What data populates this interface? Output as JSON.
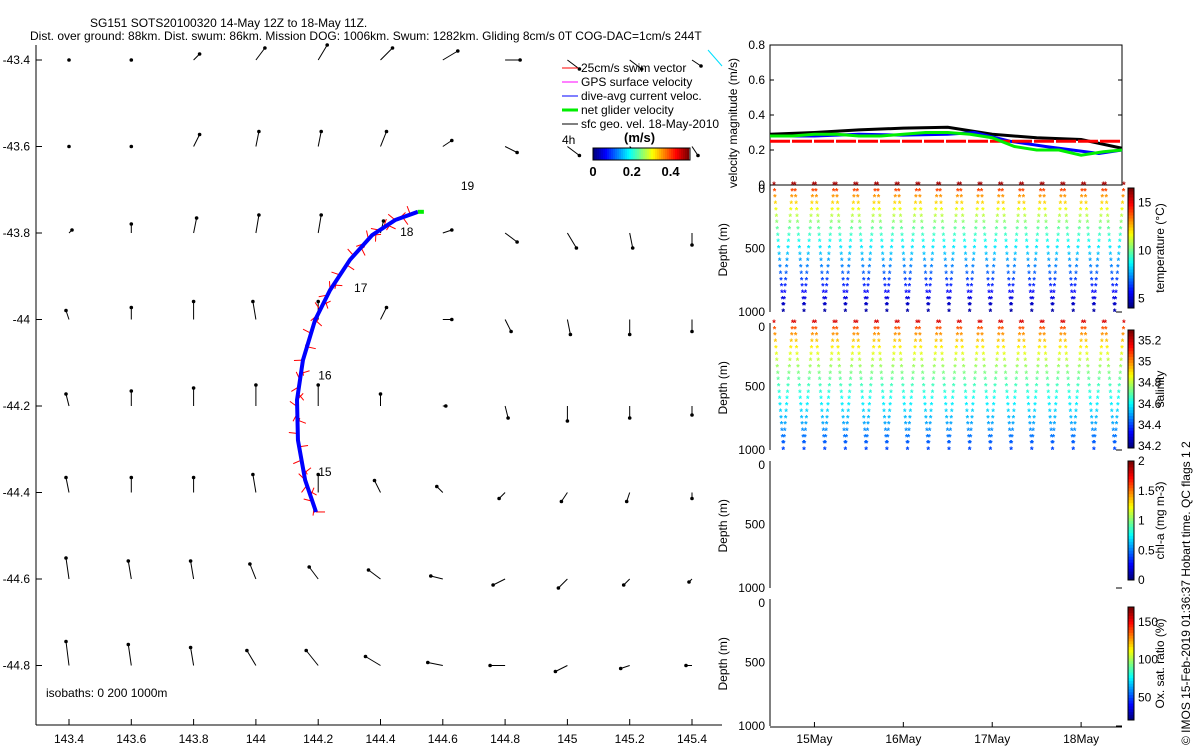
{
  "title": "SG151 SOTS20100320 14-May 12Z to 18-May 11Z.",
  "subtitle": "Dist. over ground: 88km. Dist. swum: 86km. Mission DOG: 1006km. Swum: 1282km. Gliding 8cm/s 0T COG-DAC=1cm/s 244T",
  "footer_note": "© IMOS 15-Feb-2019 01:36:37 Hobart time. QC flags 1  2",
  "chart_data": [
    {
      "type": "map-vector",
      "xlim": [
        143.3,
        145.5
      ],
      "ylim": [
        -44.92,
        -43.35
      ],
      "xticks": [
        "143.4",
        "143.6",
        "143.8",
        "144",
        "144.2",
        "144.4",
        "144.6",
        "144.8",
        "145",
        "145.2",
        "145.4"
      ],
      "yticks": [
        "-43.4",
        "-43.6",
        "-43.8",
        "-44",
        "-44.2",
        "-44.4",
        "-44.6",
        "-44.8"
      ],
      "isobath_label": "isobaths: 0   200  1000m",
      "legend": [
        {
          "label": "25cm/s swim vector",
          "color": "#ff0000"
        },
        {
          "label": "GPS surface velocity",
          "color": "#ff00ff"
        },
        {
          "label": "dive-avg current veloc.",
          "color": "#0000ff"
        },
        {
          "label": "net glider velocity",
          "color": "#00ee00"
        },
        {
          "label": "sfc geo. vel. 18-May-2010",
          "color": "#000000"
        }
      ],
      "time_label": "4h",
      "colorbar": {
        "label": "(m/s)",
        "range": [
          0,
          0.5
        ],
        "ticks": [
          "0",
          "0.2",
          "0.4"
        ]
      },
      "track": [
        [
          144.193,
          -44.445
        ],
        [
          144.158,
          -44.371
        ],
        [
          144.135,
          -44.279
        ],
        [
          144.132,
          -44.186
        ],
        [
          144.151,
          -44.094
        ],
        [
          144.19,
          -44.001
        ],
        [
          144.238,
          -43.932
        ],
        [
          144.302,
          -43.862
        ],
        [
          144.373,
          -43.805
        ],
        [
          144.447,
          -43.77
        ],
        [
          144.52,
          -43.751
        ]
      ],
      "day_labels": [
        {
          "t": "15",
          "lon": 144.2,
          "lat": -44.353
        },
        {
          "t": "16",
          "lon": 144.2,
          "lat": -44.13
        },
        {
          "t": "17",
          "lon": 144.315,
          "lat": -43.927
        },
        {
          "t": "18",
          "lon": 144.463,
          "lat": -43.798
        },
        {
          "t": "19",
          "lon": 144.658,
          "lat": -43.691
        }
      ],
      "grid_lons": [
        143.4,
        143.6,
        143.8,
        144,
        144.2,
        144.4,
        144.6,
        144.8,
        145,
        145.2,
        145.4
      ],
      "grid_lats": [
        -43.4,
        -43.6,
        -43.8,
        -44,
        -44.2,
        -44.4,
        -44.6,
        -44.8
      ],
      "geo_vel_uv": [
        [
          [
            0,
            0
          ],
          [
            0,
            0
          ],
          [
            2,
            2
          ],
          [
            3,
            4
          ],
          [
            3,
            5
          ],
          [
            4,
            4
          ],
          [
            5,
            3
          ],
          [
            5,
            0
          ],
          [
            4,
            -3
          ],
          [
            4,
            -3
          ],
          [
            3,
            -2
          ]
        ],
        [
          [
            0,
            0
          ],
          [
            0,
            0
          ],
          [
            2,
            4
          ],
          [
            1,
            5
          ],
          [
            1,
            5
          ],
          [
            2,
            5
          ],
          [
            3,
            2
          ],
          [
            4,
            -2
          ],
          [
            4,
            -3
          ],
          [
            3,
            -3
          ],
          [
            2,
            -3
          ]
        ],
        [
          [
            1,
            1
          ],
          [
            0,
            3
          ],
          [
            1,
            5
          ],
          [
            1,
            6
          ],
          [
            1,
            6
          ],
          [
            1,
            4
          ],
          [
            3,
            1
          ],
          [
            4,
            -3
          ],
          [
            3,
            -5
          ],
          [
            1,
            -5
          ],
          [
            0,
            -4
          ]
        ],
        [
          [
            -1,
            3
          ],
          [
            0,
            4
          ],
          [
            0,
            6
          ],
          [
            -1,
            6
          ],
          [
            0,
            6
          ],
          [
            2,
            4
          ],
          [
            3,
            0
          ],
          [
            2,
            -4
          ],
          [
            1,
            -5
          ],
          [
            0,
            -5
          ],
          [
            0,
            -4
          ]
        ],
        [
          [
            -1,
            4
          ],
          [
            0,
            5
          ],
          [
            0,
            6
          ],
          [
            0,
            7
          ],
          [
            0,
            7
          ],
          [
            0,
            4
          ],
          [
            1,
            0
          ],
          [
            1,
            -4
          ],
          [
            0,
            -5
          ],
          [
            0,
            -4
          ],
          [
            0,
            -3
          ]
        ],
        [
          [
            -1,
            5
          ],
          [
            0,
            5
          ],
          [
            0,
            5
          ],
          [
            -1,
            6
          ],
          [
            0,
            6
          ],
          [
            -2,
            4
          ],
          [
            -2,
            2
          ],
          [
            -2,
            -2
          ],
          [
            -2,
            -3
          ],
          [
            -1,
            -3
          ],
          [
            0,
            -2
          ]
        ],
        [
          [
            -1,
            7
          ],
          [
            -1,
            6
          ],
          [
            -1,
            6
          ],
          [
            -2,
            5
          ],
          [
            -3,
            4
          ],
          [
            -4,
            3
          ],
          [
            -4,
            1
          ],
          [
            -4,
            -2
          ],
          [
            -3,
            -3
          ],
          [
            -2,
            -2
          ],
          [
            -1,
            -1
          ]
        ],
        [
          [
            -1,
            8
          ],
          [
            -1,
            7
          ],
          [
            -1,
            6
          ],
          [
            -3,
            5
          ],
          [
            -4,
            5
          ],
          [
            -5,
            3
          ],
          [
            -5,
            1
          ],
          [
            -5,
            0
          ],
          [
            -4,
            -2
          ],
          [
            -3,
            -1
          ],
          [
            -2,
            0
          ]
        ]
      ]
    },
    {
      "type": "line",
      "ylabel": "velocity magnitude (m/s)",
      "ylim": [
        0,
        0.8
      ],
      "yticks": [
        "0",
        "0.2",
        "0.4",
        "0.6",
        "0.8"
      ],
      "xlim": [
        14.5,
        18.46
      ],
      "series": [
        {
          "color": "#000000",
          "x": [
            14.5,
            15,
            15.5,
            16,
            16.5,
            17,
            17.5,
            18,
            18.46
          ],
          "y": [
            0.29,
            0.3,
            0.315,
            0.325,
            0.33,
            0.29,
            0.27,
            0.26,
            0.21
          ]
        },
        {
          "color": "#0000ff",
          "x": [
            14.5,
            15,
            15.5,
            16,
            16.5,
            16.8,
            17.2,
            17.6,
            18.2,
            18.46
          ],
          "y": [
            0.28,
            0.28,
            0.29,
            0.285,
            0.29,
            0.3,
            0.25,
            0.22,
            0.18,
            0.2
          ]
        },
        {
          "color": "#ff0000",
          "x": [
            14.5,
            18.46
          ],
          "y": [
            0.25,
            0.25
          ]
        },
        {
          "color": "#00ee00",
          "x": [
            14.5,
            14.75,
            15,
            15.25,
            15.5,
            15.75,
            16,
            16.25,
            16.5,
            16.75,
            17,
            17.25,
            17.5,
            17.75,
            18,
            18.25,
            18.46
          ],
          "y": [
            0.28,
            0.28,
            0.29,
            0.29,
            0.28,
            0.28,
            0.29,
            0.3,
            0.3,
            0.29,
            0.27,
            0.22,
            0.2,
            0.2,
            0.17,
            0.19,
            0.2
          ]
        }
      ]
    },
    {
      "type": "scatter",
      "ylabel": "Depth (m)",
      "cbar_label": "temperature (°C)",
      "clim": [
        4,
        16.5
      ],
      "cticks": [
        5,
        10,
        15
      ],
      "surface": 16,
      "deep": 4.5,
      "yticks": [
        "0",
        "500",
        "1000"
      ]
    },
    {
      "type": "scatter",
      "ylabel": "Depth (m)",
      "cbar_label": "salinity",
      "clim": [
        34.18,
        35.3
      ],
      "cticks": [
        34.2,
        34.4,
        34.6,
        34.8,
        35,
        35.2
      ],
      "surface": 35.2,
      "deep": 34.4,
      "yticks": [
        "0",
        "500",
        "1000"
      ]
    },
    {
      "type": "scatter",
      "ylabel": "Depth (m)",
      "cbar_label": "chl-a (mg m-3)",
      "clim": [
        0,
        2
      ],
      "cticks": [
        0,
        0.5,
        1,
        1.5,
        2
      ],
      "yticks": [
        "0",
        "500",
        "1000"
      ]
    },
    {
      "type": "scatter",
      "ylabel": "Depth (m)",
      "cbar_label": "Ox. sat. ratio (%)",
      "clim": [
        20,
        170
      ],
      "cticks": [
        50,
        100,
        150
      ],
      "yticks": [
        "0",
        "500",
        "1000"
      ]
    }
  ],
  "dives": {
    "count": 17,
    "max_depth_m": 1000
  },
  "time_axis": {
    "ticks": [
      {
        "label": "15May",
        "day": 15
      },
      {
        "label": "16May",
        "day": 16
      },
      {
        "label": "17May",
        "day": 17
      },
      {
        "label": "18May",
        "day": 18
      }
    ]
  }
}
